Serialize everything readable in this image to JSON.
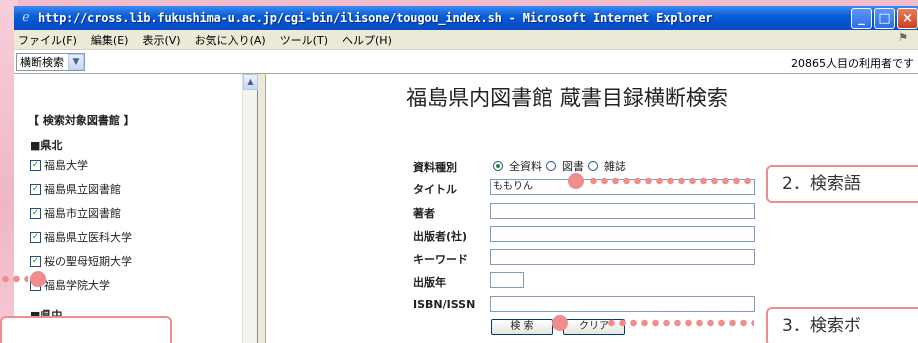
{
  "window": {
    "title": "http://cross.lib.fukushima-u.ac.jp/cgi-bin/ilisone/tougou_index.sh - Microsoft Internet Explorer",
    "minimize": "_",
    "maximize": "□",
    "close": "×"
  },
  "menu": {
    "items": [
      "ファイル(F)",
      "編集(E)",
      "表示(V)",
      "お気に入り(A)",
      "ツール(T)",
      "ヘルプ(H)"
    ]
  },
  "toolbar": {
    "select_value": "横断検索",
    "visitor_count": "20865人目の利用者です"
  },
  "sidebar": {
    "title": "【 検索対象図書館 】",
    "regions": [
      {
        "name": "■県北"
      },
      {
        "name": "■県中"
      }
    ],
    "libraries": [
      {
        "label": "福島大学",
        "checked": true
      },
      {
        "label": "福島県立図書館",
        "checked": true
      },
      {
        "label": "福島市立図書館",
        "checked": true
      },
      {
        "label": "福島県立医科大学",
        "checked": true
      },
      {
        "label": "桜の聖母短期大学",
        "checked": true
      },
      {
        "label": "福島学院大学",
        "checked": true
      }
    ]
  },
  "search": {
    "title": "福島県内図書館 蔵書目録横断検索",
    "material_type_label": "資料種別",
    "material_options": [
      {
        "label": "全資料",
        "selected": true
      },
      {
        "label": "図書",
        "selected": false
      },
      {
        "label": "雑誌",
        "selected": false
      }
    ],
    "title_label": "タイトル",
    "title_value": "ももりん",
    "author_label": "著者",
    "publisher_label": "出版者(社)",
    "keyword_label": "キーワード",
    "year_label": "出版年",
    "isbn_label": "ISBN/ISSN",
    "search_button": "検 索",
    "clear_button": "クリア"
  },
  "annotations": {
    "step2": "2．検索語",
    "step3": "3．検索ボ"
  },
  "colors": {
    "accent": "#f08c8c",
    "titlebar": "#0a5fd8"
  }
}
